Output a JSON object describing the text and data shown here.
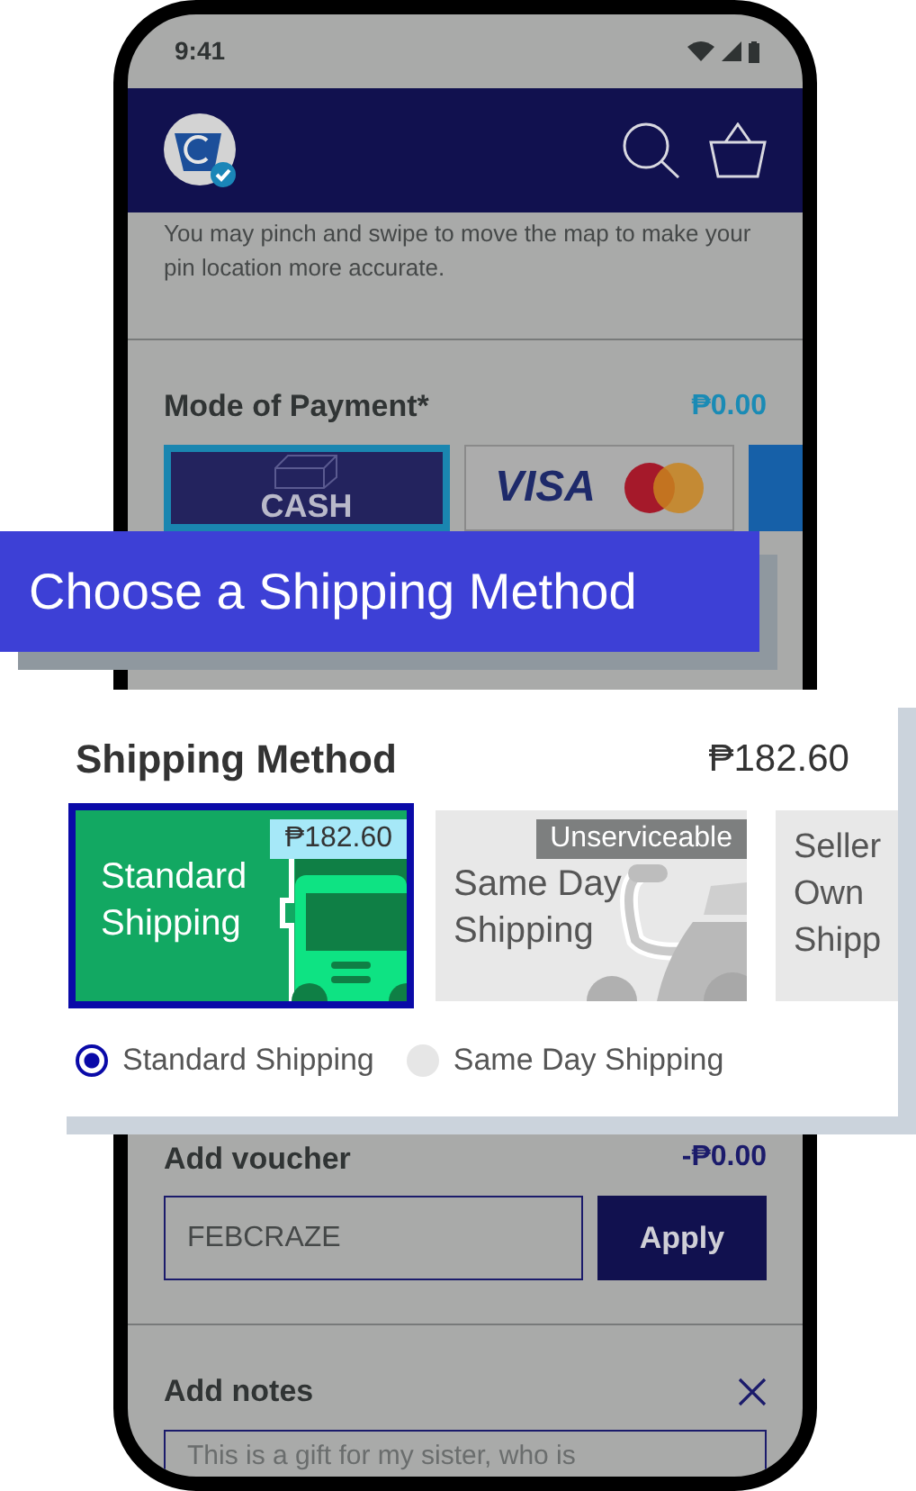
{
  "status_bar": {
    "time": "9:41"
  },
  "map_hint": "You may pinch and swipe to move the map to make your pin location more accurate.",
  "payment": {
    "title": "Mode of Payment*",
    "amount": "₱0.00",
    "options": [
      {
        "kind": "cash",
        "label": "CASH",
        "selected": true
      },
      {
        "kind": "card",
        "label": "VISA",
        "selected": false
      }
    ]
  },
  "banner": {
    "text": "Choose a Shipping Method"
  },
  "shipping": {
    "title": "Shipping Method",
    "amount": "₱182.60",
    "options": [
      {
        "kind": "truck",
        "label": "Standard Shipping",
        "tag": "₱182.60",
        "selected": true
      },
      {
        "kind": "scooter",
        "label": "Same Day Shipping",
        "tag": "Unserviceable",
        "selected": false
      },
      {
        "kind": "plain",
        "label": "Seller Own Shipp",
        "selected": false
      }
    ],
    "radios": [
      {
        "label": "Standard Shipping",
        "selected": true
      },
      {
        "label": "Same Day Shipping",
        "selected": false
      }
    ]
  },
  "voucher": {
    "title": "Add voucher",
    "amount": "-₱0.00",
    "value": "FEBCRAZE",
    "button": "Apply"
  },
  "notes": {
    "title": "Add notes",
    "value": "This is a gift for my sister, who is"
  }
}
